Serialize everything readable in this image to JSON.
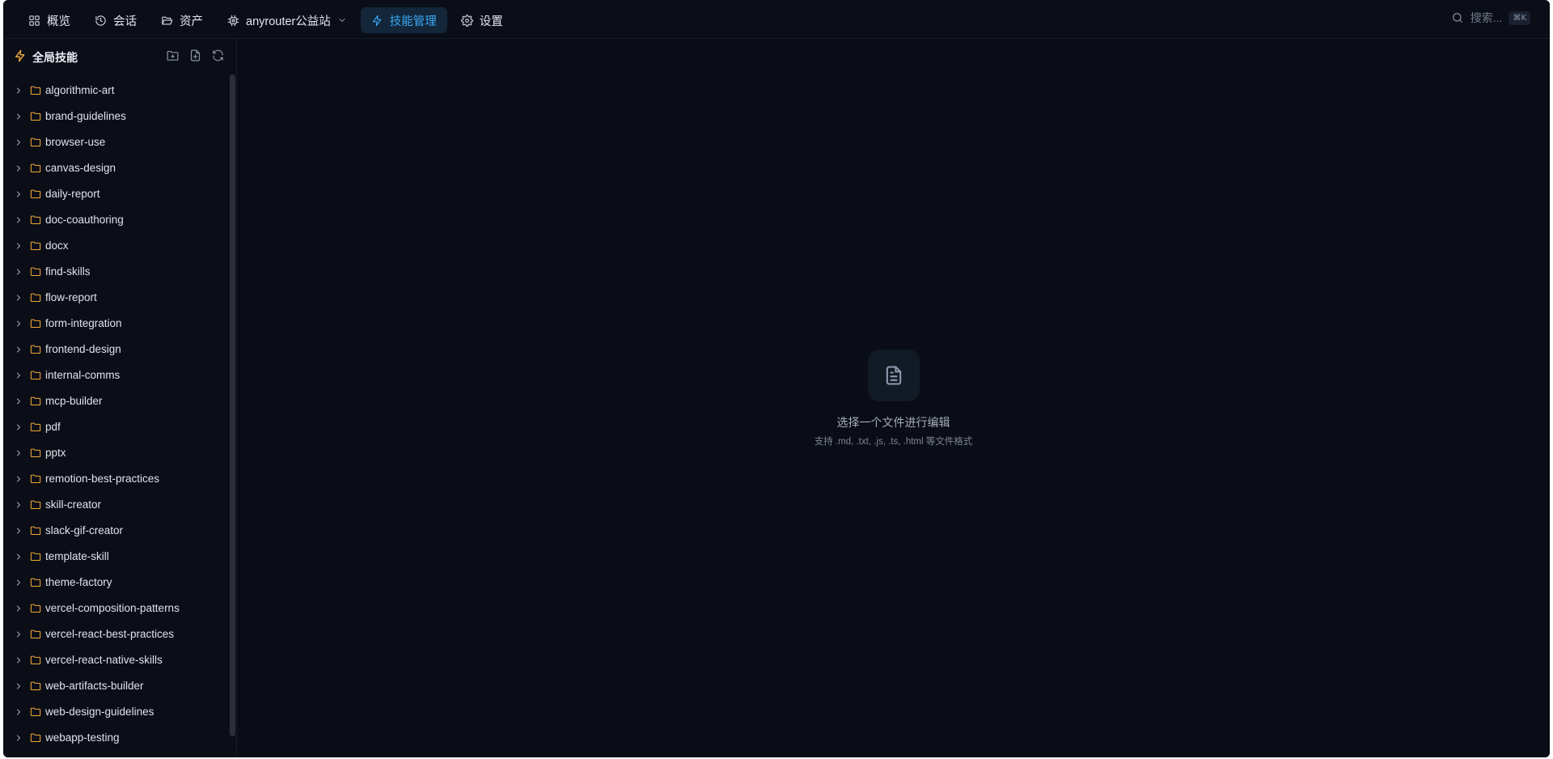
{
  "nav": {
    "items": [
      {
        "label": "概览",
        "icon": "grid-icon"
      },
      {
        "label": "会话",
        "icon": "history-icon"
      },
      {
        "label": "资产",
        "icon": "folder-open-icon"
      },
      {
        "label": "anyrouter公益站",
        "icon": "chip-icon"
      },
      {
        "label": "技能管理",
        "icon": "bolt-icon",
        "active": true
      },
      {
        "label": "设置",
        "icon": "gear-icon"
      }
    ]
  },
  "search": {
    "placeholder": "搜索...",
    "shortcut": "⌘K"
  },
  "sidebar": {
    "title": "全局技能",
    "items": [
      "algorithmic-art",
      "brand-guidelines",
      "browser-use",
      "canvas-design",
      "daily-report",
      "doc-coauthoring",
      "docx",
      "find-skills",
      "flow-report",
      "form-integration",
      "frontend-design",
      "internal-comms",
      "mcp-builder",
      "pdf",
      "pptx",
      "remotion-best-practices",
      "skill-creator",
      "slack-gif-creator",
      "template-skill",
      "theme-factory",
      "vercel-composition-patterns",
      "vercel-react-best-practices",
      "vercel-react-native-skills",
      "web-artifacts-builder",
      "web-design-guidelines",
      "webapp-testing"
    ]
  },
  "main": {
    "empty_title": "选择一个文件进行编辑",
    "empty_subtitle": "支持 .md, .txt, .js, .ts, .html 等文件格式"
  },
  "colors": {
    "accent": "#3aa8f2",
    "folder": "#f0a93a",
    "background": "#0a0d16"
  }
}
